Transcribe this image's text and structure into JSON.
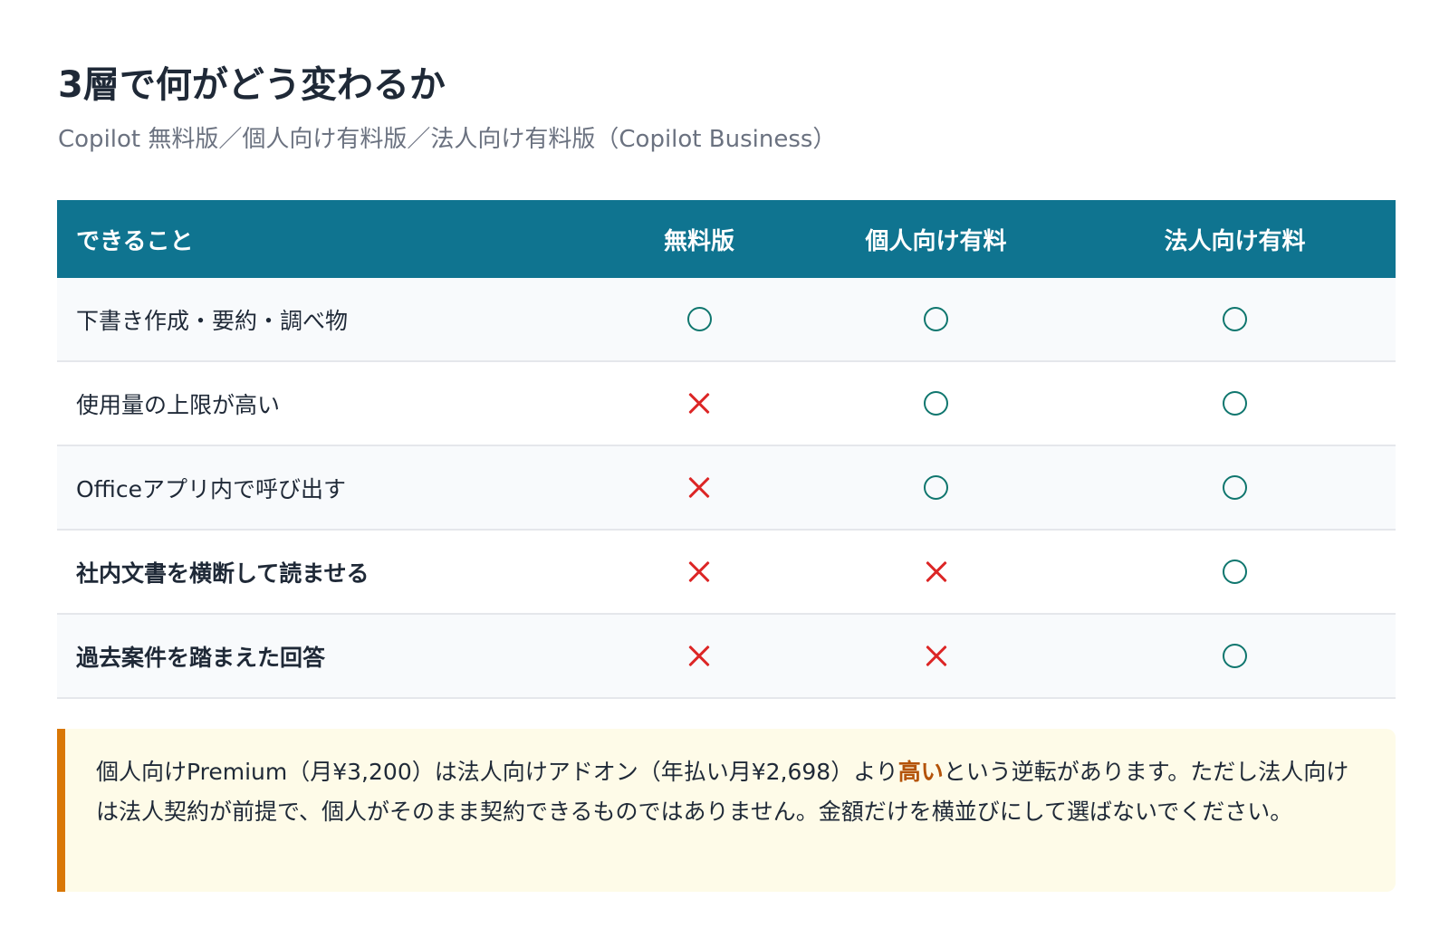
{
  "header": {
    "title": "3層で何がどう変わるか",
    "subtitle": "Copilot 無料版／個人向け有料版／法人向け有料版（Copilot Business）"
  },
  "table": {
    "columns": [
      "できること",
      "無料版",
      "個人向け有料",
      "法人向け有料"
    ],
    "rows": [
      {
        "feature": "下書き作成・要約・調べ物",
        "bold": false,
        "values": [
          "○",
          "○",
          "○"
        ]
      },
      {
        "feature": "使用量の上限が高い",
        "bold": false,
        "values": [
          "×",
          "○",
          "○"
        ]
      },
      {
        "feature": "Officeアプリ内で呼び出す",
        "bold": false,
        "values": [
          "×",
          "○",
          "○"
        ]
      },
      {
        "feature": "社内文書を横断して読ませる",
        "bold": true,
        "values": [
          "×",
          "×",
          "○"
        ]
      },
      {
        "feature": "過去案件を踏まえた回答",
        "bold": true,
        "values": [
          "×",
          "×",
          "○"
        ]
      }
    ],
    "mark_names": {
      "○": "available",
      "×": "unavailable"
    }
  },
  "note": {
    "before": "個人向けPremium（月¥3,200）は法人向けアドオン（年払い月¥2,698）より",
    "highlight": "高い",
    "after": "という逆転があります。ただし法人向けは法人契約が前提で、個人がそのまま契約できるものではありません。金額だけを横並びにして選ばないでください。"
  },
  "colors": {
    "header_bg": "#0f7490",
    "circle_mark": "#0f766e",
    "cross_mark": "#dc2626",
    "note_bg": "#fefbe8",
    "note_border": "#d97706",
    "highlight_text": "#b45309"
  }
}
